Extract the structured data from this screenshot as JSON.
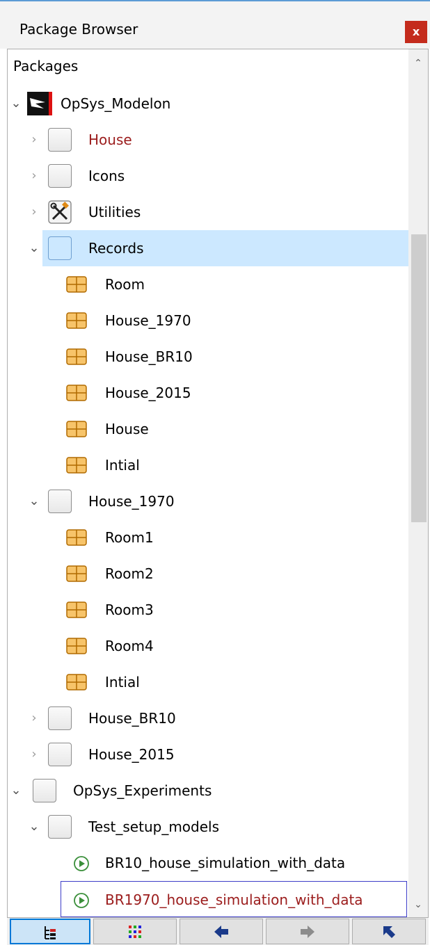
{
  "window": {
    "title": "Package Browser",
    "close_glyph": "x",
    "accent_color": "#5b9bd5",
    "close_color": "#c42b1c"
  },
  "tree": {
    "header": "Packages",
    "nodes": [
      {
        "label": "OpSys_Modelon",
        "icon": "modelon-logo-icon",
        "state": "expanded"
      },
      {
        "label": "House",
        "icon": "package-icon",
        "state": "collapsed"
      },
      {
        "label": "Icons",
        "icon": "package-icon",
        "state": "collapsed"
      },
      {
        "label": "Utilities",
        "icon": "tools-icon",
        "state": "collapsed"
      },
      {
        "label": "Records",
        "icon": "package-icon",
        "state": "expanded",
        "selected": true
      },
      {
        "label": "Room",
        "icon": "record-icon"
      },
      {
        "label": "House_1970",
        "icon": "record-icon"
      },
      {
        "label": "House_BR10",
        "icon": "record-icon"
      },
      {
        "label": "House_2015",
        "icon": "record-icon"
      },
      {
        "label": "House",
        "icon": "record-icon"
      },
      {
        "label": "Intial",
        "icon": "record-icon"
      },
      {
        "label": "House_1970",
        "icon": "package-icon",
        "state": "expanded"
      },
      {
        "label": "Room1",
        "icon": "record-icon"
      },
      {
        "label": "Room2",
        "icon": "record-icon"
      },
      {
        "label": "Room3",
        "icon": "record-icon"
      },
      {
        "label": "Room4",
        "icon": "record-icon"
      },
      {
        "label": "Intial",
        "icon": "record-icon"
      },
      {
        "label": "House_BR10",
        "icon": "package-icon",
        "state": "collapsed"
      },
      {
        "label": "House_2015",
        "icon": "package-icon",
        "state": "collapsed"
      },
      {
        "label": "OpSys_Experiments",
        "icon": "package-icon",
        "state": "expanded"
      },
      {
        "label": "Test_setup_models",
        "icon": "package-icon",
        "state": "expanded"
      },
      {
        "label": "BR10_house_simulation_with_data",
        "icon": "simulation-icon"
      },
      {
        "label": "BR1970_house_simulation_with_data",
        "icon": "simulation-icon",
        "focused": true
      }
    ]
  },
  "toolbar": {
    "buttons": [
      {
        "icon": "tree-view-icon",
        "active": true
      },
      {
        "icon": "grid-view-icon",
        "active": false
      },
      {
        "icon": "back-arrow-icon",
        "active": false
      },
      {
        "icon": "forward-arrow-icon",
        "active": false
      },
      {
        "icon": "up-left-arrow-icon",
        "active": false
      }
    ]
  }
}
